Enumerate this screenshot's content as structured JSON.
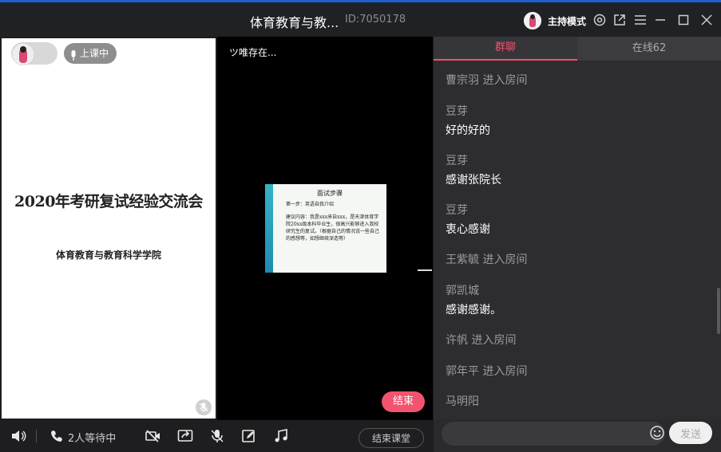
{
  "window": {
    "title": "体育教育与教...",
    "room_id": "ID:7050178",
    "host_mode": "主持模式"
  },
  "slide": {
    "live_badge": "上课中",
    "title": "2020年考研复试经验交流会",
    "subtitle": "体育教育与教育科学学院"
  },
  "video": {
    "saving_status": "ツ唯存在...",
    "shared_slide": {
      "heading": "面试步骤",
      "step": "第一步：英语自我介绍",
      "body": "建议内容：我是xxx来自xxx，是天津体育学院20xx级本科毕业生，很高兴能够进入我校研究生的复试。（根据自己的情况说一些自己的感想等，如想继续深造等）"
    },
    "end_share_label": "结束"
  },
  "toolbar": {
    "waiting": "2人等待中",
    "end_class_label": "结束课堂"
  },
  "chat": {
    "tabs": [
      {
        "label": "群聊"
      },
      {
        "label": "在线62"
      }
    ],
    "messages": [
      {
        "name": "曹宗羽 进入房间",
        "text": ""
      },
      {
        "name": "豆芽",
        "text": "好的好的"
      },
      {
        "name": "豆芽",
        "text": "感谢张院长"
      },
      {
        "name": "豆芽",
        "text": "衷心感谢"
      },
      {
        "name": "王紫毓 进入房间",
        "text": ""
      },
      {
        "name": "郭凯城",
        "text": "感谢感谢。"
      },
      {
        "name": "许帆 进入房间",
        "text": ""
      },
      {
        "name": "郭年平 进入房间",
        "text": ""
      },
      {
        "name": "马明阳",
        "text": ""
      }
    ],
    "input_placeholder": "",
    "send_label": "发送"
  },
  "colors": {
    "accent": "#f2536e",
    "panel": "#2d2d30",
    "titlebar_border": "#1c5fd0"
  }
}
